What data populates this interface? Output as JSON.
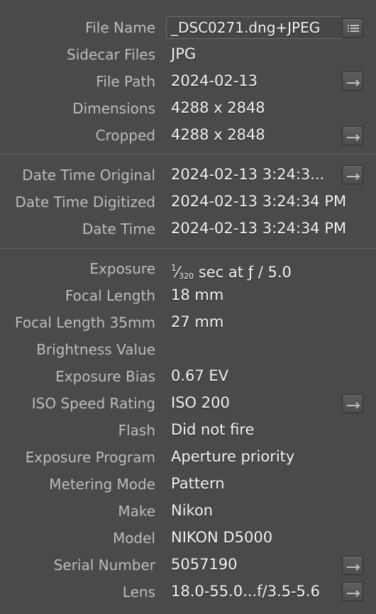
{
  "metadata_panel": {
    "file_name": {
      "label": "File Name",
      "value": "_DSC0271.dng+JPEG"
    },
    "sidecar_files": {
      "label": "Sidecar Files",
      "value": "JPG"
    },
    "file_path": {
      "label": "File Path",
      "value": "2024-02-13"
    },
    "dimensions": {
      "label": "Dimensions",
      "value": "4288 x 2848"
    },
    "cropped": {
      "label": "Cropped",
      "value": "4288 x 2848"
    },
    "date_time_original": {
      "label": "Date Time Original",
      "value": "2024-02-13 3:24:3..."
    },
    "date_time_digitized": {
      "label": "Date Time Digitized",
      "value": "2024-02-13 3:24:34 PM"
    },
    "date_time": {
      "label": "Date Time",
      "value": "2024-02-13 3:24:34 PM"
    },
    "exposure": {
      "label": "Exposure",
      "numerator": "1",
      "denominator": "320",
      "value_rest": "sec at ƒ / 5.0"
    },
    "focal_length": {
      "label": "Focal Length",
      "value": "18 mm"
    },
    "focal_length_35mm": {
      "label": "Focal Length 35mm",
      "value": "27 mm"
    },
    "brightness_value": {
      "label": "Brightness Value",
      "value": ""
    },
    "exposure_bias": {
      "label": "Exposure Bias",
      "value": "0.67 EV"
    },
    "iso_speed_rating": {
      "label": "ISO Speed Rating",
      "value": "ISO 200"
    },
    "flash": {
      "label": "Flash",
      "value": "Did not fire"
    },
    "exposure_program": {
      "label": "Exposure Program",
      "value": "Aperture priority"
    },
    "metering_mode": {
      "label": "Metering Mode",
      "value": "Pattern"
    },
    "make": {
      "label": "Make",
      "value": "Nikon"
    },
    "model": {
      "label": "Model",
      "value": "NIKON D5000"
    },
    "serial_number": {
      "label": "Serial Number",
      "value": "5057190"
    },
    "lens": {
      "label": "Lens",
      "value": "18.0-55.0...f/3.5-5.6"
    }
  },
  "icons": {
    "rename": "list-icon",
    "go_to": "arrow-right-icon"
  },
  "colors": {
    "background": "#4a4a4a",
    "label": "#bdbdbd",
    "value": "#f4f4f4"
  }
}
